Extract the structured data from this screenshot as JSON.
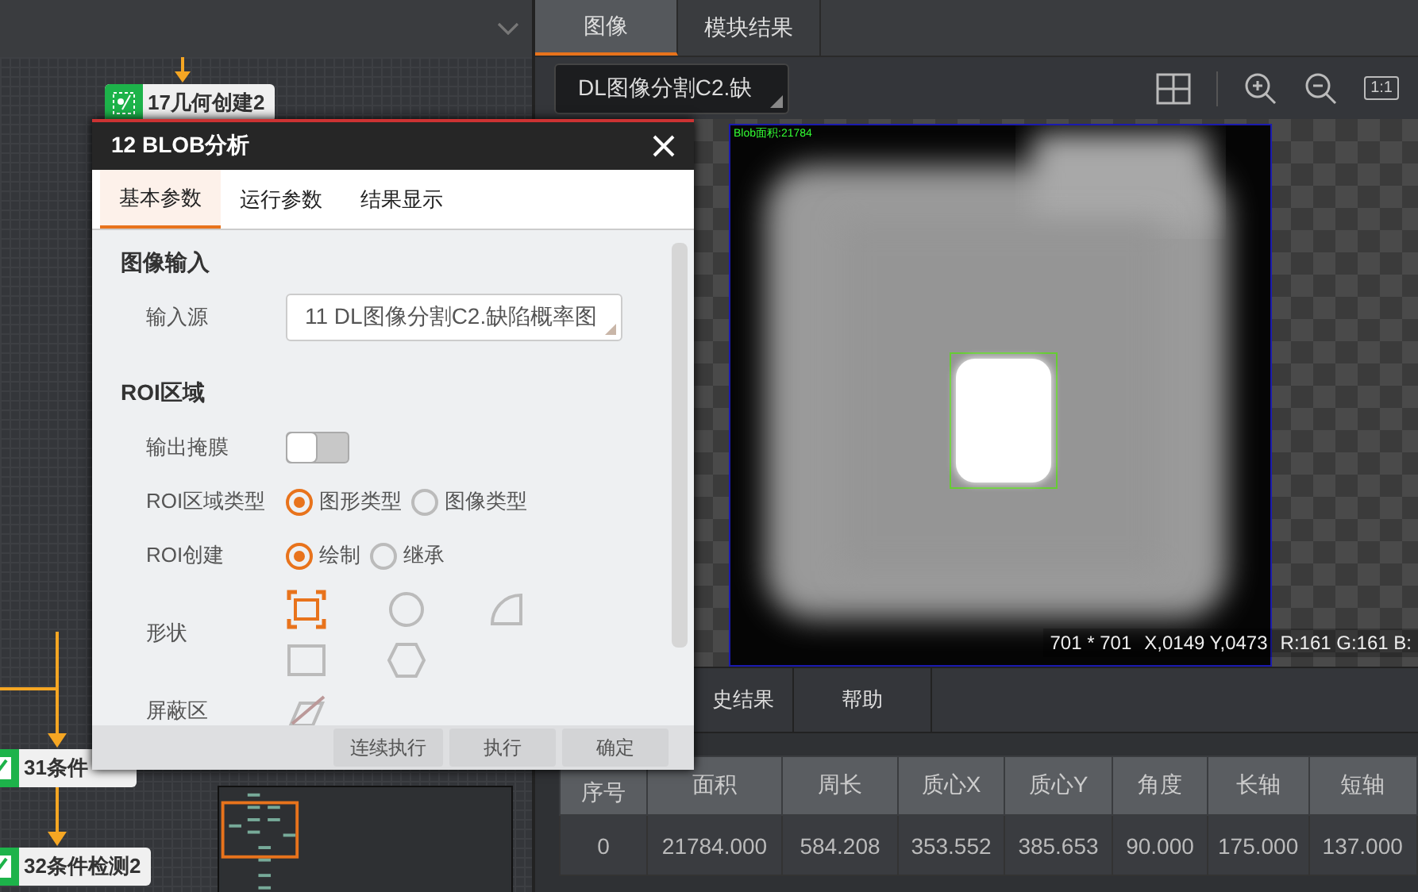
{
  "flow_canvas": {
    "nodes": [
      {
        "label": "17几何创建2",
        "kind": "geometry"
      },
      {
        "label": "31条件",
        "kind": "condition"
      },
      {
        "label": "32条件检测2",
        "kind": "condition"
      }
    ]
  },
  "image_panel": {
    "tabs": [
      {
        "label": "图像",
        "selected": true
      },
      {
        "label": "模块结果",
        "selected": false
      }
    ],
    "source": {
      "value": "DL图像分割C2.缺"
    },
    "zoom_label": "1:1",
    "overlay_label": "Blob面积:21784",
    "status": [
      "701 * 701",
      "X,0149  Y,0473",
      "R:161  G:161  B:"
    ]
  },
  "bottom_tabs": [
    {
      "label": "史结果",
      "selected": false
    },
    {
      "label": "帮助",
      "selected": false
    }
  ],
  "table": {
    "columns": [
      "序号",
      "面积",
      "周长",
      "质心X",
      "质心Y",
      "角度",
      "长轴",
      "短轴"
    ],
    "rows": [
      [
        "0",
        "21784.000",
        "584.208",
        "353.552",
        "385.653",
        "90.000",
        "175.000",
        "137.000"
      ]
    ]
  },
  "dialog": {
    "title": "12 BLOB分析",
    "tabs": [
      {
        "label": "基本参数",
        "selected": true
      },
      {
        "label": "运行参数",
        "selected": false
      },
      {
        "label": "结果显示",
        "selected": false
      }
    ],
    "sections": [
      {
        "heading": "图像输入",
        "rows": [
          {
            "kind": "select",
            "label": "输入源",
            "value": "11 DL图像分割C2.缺陷概率图"
          }
        ]
      },
      {
        "heading": "ROI区域",
        "rows": [
          {
            "kind": "toggle",
            "label": "输出掩膜",
            "on": false
          },
          {
            "kind": "radio",
            "label": "ROI区域类型",
            "options": [
              {
                "label": "图形类型",
                "selected": true
              },
              {
                "label": "图像类型",
                "selected": false
              }
            ]
          },
          {
            "kind": "radio",
            "label": "ROI创建",
            "options": [
              {
                "label": "绘制",
                "selected": true
              },
              {
                "label": "继承",
                "selected": false
              }
            ]
          },
          {
            "kind": "shapes",
            "label": "形状",
            "shapes": [
              {
                "kind": "bbox",
                "selected": true
              },
              {
                "kind": "circle",
                "selected": false
              },
              {
                "kind": "sector",
                "selected": false
              },
              {
                "kind": "rect",
                "selected": false
              },
              {
                "kind": "hexagon",
                "selected": false
              }
            ]
          },
          {
            "kind": "mask",
            "label": "屏蔽区"
          }
        ]
      }
    ],
    "buttons": [
      "连续执行",
      "执行",
      "确定"
    ]
  }
}
